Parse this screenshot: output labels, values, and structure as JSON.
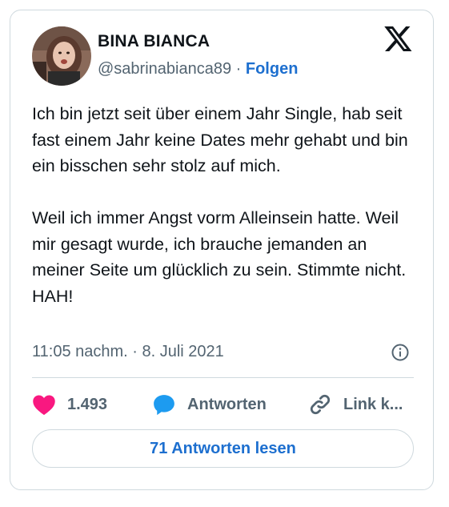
{
  "author": {
    "display_name": "BINA BIANCA",
    "handle": "@sabrinabianca89",
    "separator": " · ",
    "follow_label": "Folgen"
  },
  "tweet": {
    "paragraphs": [
      "Ich bin jetzt seit über einem Jahr Single, hab seit fast einem Jahr keine Dates mehr gehabt und bin ein bisschen sehr stolz auf mich.",
      "Weil ich immer Angst vorm Alleinsein hatte. Weil mir gesagt wurde, ich brauche jemanden an meiner Seite um glücklich zu sein. Stimmte nicht. HAH!"
    ],
    "timestamp": "11:05 nachm. · 8. Juli 2021"
  },
  "actions": {
    "likes_count": "1.493",
    "reply_label": "Antworten",
    "link_label": "Link k..."
  },
  "footer": {
    "read_replies_label": "71 Antworten lesen"
  },
  "icons": {
    "platform": "x-logo-icon",
    "info": "info-icon",
    "like": "heart-icon",
    "reply": "speech-bubble-icon",
    "link": "link-icon"
  },
  "colors": {
    "like": "#f91880",
    "reply": "#1d9bf0",
    "link_accent": "#1d6fcf",
    "secondary_text": "#536471",
    "border": "#cfd9de"
  }
}
